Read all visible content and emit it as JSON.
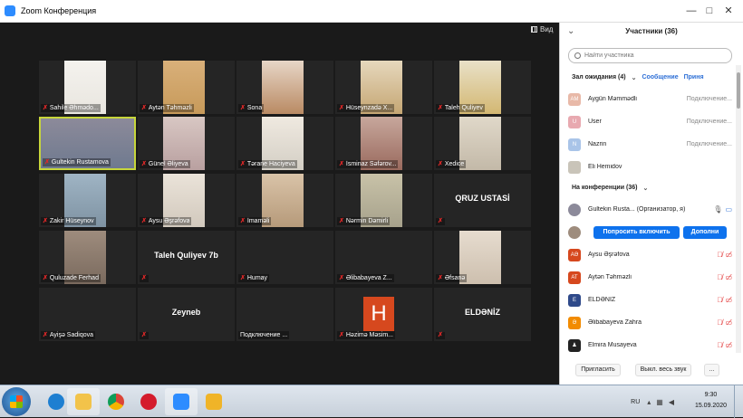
{
  "window": {
    "title": "Zoom Конференция",
    "minimize": "—",
    "maximize": "□",
    "close": "✕"
  },
  "view_label": "Вид",
  "tiles": [
    {
      "name": "Sahile Əhmədo...",
      "bg": "#e9e6df",
      "photo": "#f4f2ee"
    },
    {
      "name": "Aytən Təhməzli",
      "bg": "#c79a5a",
      "photo": "#d9b07a"
    },
    {
      "name": "Sona",
      "bg": "#b98a63",
      "photo": "#e7d6c7"
    },
    {
      "name": "Hüseynzadə X...",
      "bg": "#c5a673",
      "photo": "#e6d8bd"
    },
    {
      "name": "Taleh Quliyev",
      "bg": "#d3b772",
      "photo": "#e9e1c8"
    },
    {
      "name": "Gultekin Rustamova",
      "bg": "#6f7a8f",
      "photo": "#8c8a9a",
      "active": true
    },
    {
      "name": "Günel Əliyeva",
      "bg": "#b9a0a0",
      "photo": "#d8c7c3"
    },
    {
      "name": "Tərane Haciyeva",
      "bg": "#d4cfc5",
      "photo": "#efe9e0"
    },
    {
      "name": "İsminaz Səfərov...",
      "bg": "#9a6a5e",
      "photo": "#c7a79c"
    },
    {
      "name": "Xedice",
      "bg": "#c3b9a8",
      "photo": "#e0d8c9"
    },
    {
      "name": "Zakir Hüseynov",
      "bg": "#7f93a3",
      "photo": "#9fb4c4"
    },
    {
      "name": "Aysu Əşrəfova",
      "bg": "#d2c9bd",
      "photo": "#eae3d9"
    },
    {
      "name": "İmaməli",
      "bg": "#b69a7a",
      "photo": "#d9c3a8"
    },
    {
      "name": "Nərmin Dəmirli",
      "bg": "#a7a28c",
      "photo": "#c8c2a8"
    },
    {
      "name": "QRUZ USTASİ",
      "text_only": true
    },
    {
      "name": "Quluzade Ferhad",
      "bg": "#7a6a5e",
      "photo": "#9e8c7d"
    },
    {
      "name": "Taleh Quliyev 7b",
      "text_only": true
    },
    {
      "name": "Humay",
      "empty": true
    },
    {
      "name": "Əlibabayeva Z...",
      "empty": true
    },
    {
      "name": "Əfsanə",
      "bg": "#cdbfae",
      "photo": "#e6dccf"
    },
    {
      "name": "Ayişə Sadiqova",
      "empty": true
    },
    {
      "name": "Zeyneb",
      "text_only": true
    },
    {
      "name": "Подключение ...",
      "empty": true,
      "muted_icon": false
    },
    {
      "name": "Həzimə Məsim...",
      "letter": "H"
    },
    {
      "name": "ELDƏNİZ",
      "text_only": true
    }
  ],
  "panel": {
    "title": "Участники (36)",
    "search_placeholder": "Найти участника",
    "waiting_label": "Зал ожидания (4)",
    "admit_all": "Сообщение",
    "admit": "Приня",
    "waiting": [
      {
        "name": "Aygün Məmmədli",
        "status": "Подключение...",
        "initials": "AM",
        "color": "#e8b9a8"
      },
      {
        "name": "User",
        "status": "Подключение...",
        "initials": "U",
        "color": "#e8a9b0"
      },
      {
        "name": "Nazrin",
        "status": "Подключение...",
        "initials": "N",
        "color": "#a9c4e8"
      },
      {
        "name": "Eli Hemidov",
        "status": "",
        "initials": "",
        "color": "#c9c4b9"
      }
    ],
    "in_meeting_label": "На конференции (36)",
    "host": {
      "name": "Gultekin Rusta... (Организатор, я)",
      "color": "#8c8a9a"
    },
    "ask_unmute": "Попросить включить",
    "more": "Дополни",
    "members": [
      {
        "name": "Aysu Əşrəfova",
        "initials": "AƏ",
        "color": "#d6481e"
      },
      {
        "name": "Aytən Təhməzli",
        "initials": "AT",
        "color": "#d6481e"
      },
      {
        "name": "ELDƏNİZ",
        "initials": "E",
        "color": "#2f4a8a"
      },
      {
        "name": "Əlibabayeva Zahra",
        "initials": "Ə",
        "color": "#f28b00"
      },
      {
        "name": "Elmira Musayeva",
        "initials": "♟",
        "color": "#222"
      }
    ],
    "invite": "Пригласить",
    "mute_all": "Выкл. весь звук",
    "ellipsis": "..."
  },
  "taskbar": {
    "lang": "RU",
    "time": "9:30",
    "date": "15.09.2020"
  }
}
